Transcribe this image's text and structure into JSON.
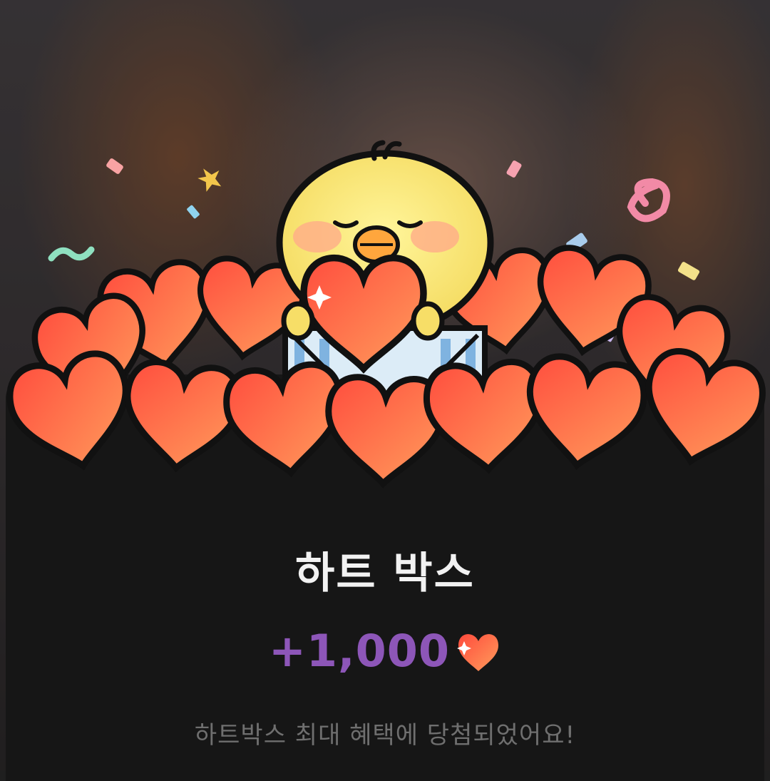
{
  "reward": {
    "title": "하트 박스",
    "amount": "+1,000",
    "message": "하트박스 최대 혜택에 당첨되었어요!"
  },
  "icons": {
    "amount_icon": "heart-icon",
    "illustration": "chick-holding-heart-in-heart-pile"
  },
  "colors": {
    "amount": "#8d56b8",
    "heart_light": "#ff9a5a",
    "heart_dark": "#ff4a3c",
    "sheet": "#161616"
  }
}
